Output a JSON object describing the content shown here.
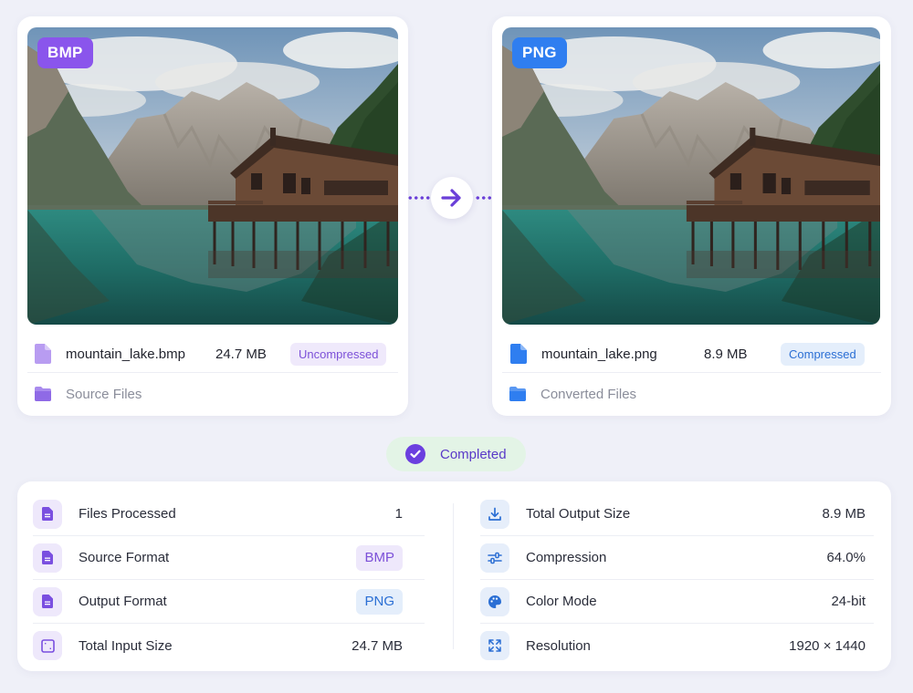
{
  "source": {
    "format_badge": "BMP",
    "file_name": "mountain_lake.bmp",
    "file_size": "24.7 MB",
    "status": "Uncompressed",
    "folder_label": "Source Files",
    "accent_color": "#8a55ec",
    "file_icon": "file-icon",
    "folder_icon": "folder-icon"
  },
  "converted": {
    "format_badge": "PNG",
    "file_name": "mountain_lake.png",
    "file_size": "8.9 MB",
    "status": "Compressed",
    "folder_label": "Converted Files",
    "accent_color": "#2f7ef0",
    "file_icon": "file-icon",
    "folder_icon": "folder-icon"
  },
  "connector_icon": "arrow-right-icon",
  "status": {
    "label": "Completed",
    "icon": "check-circle-icon"
  },
  "stats": {
    "left": [
      {
        "label": "Files Processed",
        "value": "1",
        "icon": "document-icon"
      },
      {
        "label": "Source Format",
        "value": "BMP",
        "icon": "document-icon"
      },
      {
        "label": "Output Format",
        "value": "PNG",
        "icon": "document-icon"
      },
      {
        "label": "Total Input Size",
        "value": "24.7 MB",
        "icon": "frame-icon"
      }
    ],
    "right": [
      {
        "label": "Total Output Size",
        "value": "8.9 MB",
        "icon": "download-icon"
      },
      {
        "label": "Compression",
        "value": "64.0%",
        "icon": "sliders-icon"
      },
      {
        "label": "Color Mode",
        "value": "24-bit",
        "icon": "palette-icon"
      },
      {
        "label": "Resolution",
        "value": "1920 × 1440",
        "icon": "expand-icon"
      }
    ]
  }
}
